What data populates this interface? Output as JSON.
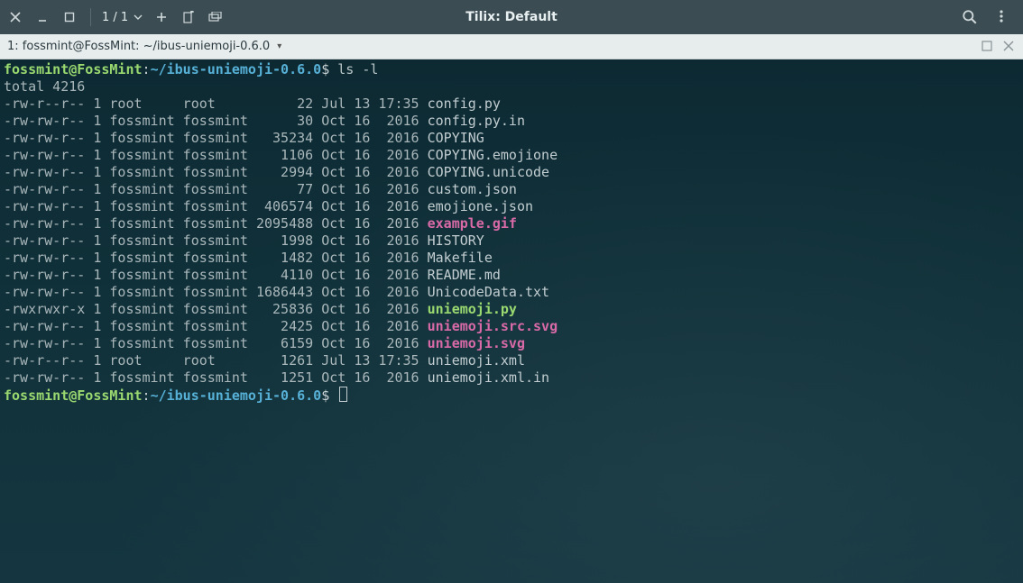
{
  "titlebar": {
    "pager": "1 / 1",
    "title": "Tilix: Default"
  },
  "tab": {
    "label": "1: fossmint@FossMint: ~/ibus-uniemoji-0.6.0"
  },
  "prompt": {
    "user_host": "fossmint@FossMint",
    "sep": ":",
    "path": "~/ibus-uniemoji-0.6.0",
    "dollar": "$",
    "cmd": "ls -l"
  },
  "total_line": "total 4216",
  "files": [
    {
      "perm": "-rw-r--r--",
      "links": "1",
      "owner": "root    ",
      "group": "root    ",
      "size": "     22",
      "date": "Jul 13 17:35",
      "name": "config.py",
      "cls": "c-file"
    },
    {
      "perm": "-rw-rw-r--",
      "links": "1",
      "owner": "fossmint",
      "group": "fossmint",
      "size": "     30",
      "date": "Oct 16  2016",
      "name": "config.py.in",
      "cls": "c-file"
    },
    {
      "perm": "-rw-rw-r--",
      "links": "1",
      "owner": "fossmint",
      "group": "fossmint",
      "size": "  35234",
      "date": "Oct 16  2016",
      "name": "COPYING",
      "cls": "c-file"
    },
    {
      "perm": "-rw-rw-r--",
      "links": "1",
      "owner": "fossmint",
      "group": "fossmint",
      "size": "   1106",
      "date": "Oct 16  2016",
      "name": "COPYING.emojione",
      "cls": "c-file"
    },
    {
      "perm": "-rw-rw-r--",
      "links": "1",
      "owner": "fossmint",
      "group": "fossmint",
      "size": "   2994",
      "date": "Oct 16  2016",
      "name": "COPYING.unicode",
      "cls": "c-file"
    },
    {
      "perm": "-rw-rw-r--",
      "links": "1",
      "owner": "fossmint",
      "group": "fossmint",
      "size": "     77",
      "date": "Oct 16  2016",
      "name": "custom.json",
      "cls": "c-file"
    },
    {
      "perm": "-rw-rw-r--",
      "links": "1",
      "owner": "fossmint",
      "group": "fossmint",
      "size": " 406574",
      "date": "Oct 16  2016",
      "name": "emojione.json",
      "cls": "c-file"
    },
    {
      "perm": "-rw-rw-r--",
      "links": "1",
      "owner": "fossmint",
      "group": "fossmint",
      "size": "2095488",
      "date": "Oct 16  2016",
      "name": "example.gif",
      "cls": "c-img"
    },
    {
      "perm": "-rw-rw-r--",
      "links": "1",
      "owner": "fossmint",
      "group": "fossmint",
      "size": "   1998",
      "date": "Oct 16  2016",
      "name": "HISTORY",
      "cls": "c-file"
    },
    {
      "perm": "-rw-rw-r--",
      "links": "1",
      "owner": "fossmint",
      "group": "fossmint",
      "size": "   1482",
      "date": "Oct 16  2016",
      "name": "Makefile",
      "cls": "c-file"
    },
    {
      "perm": "-rw-rw-r--",
      "links": "1",
      "owner": "fossmint",
      "group": "fossmint",
      "size": "   4110",
      "date": "Oct 16  2016",
      "name": "README.md",
      "cls": "c-file"
    },
    {
      "perm": "-rw-rw-r--",
      "links": "1",
      "owner": "fossmint",
      "group": "fossmint",
      "size": "1686443",
      "date": "Oct 16  2016",
      "name": "UnicodeData.txt",
      "cls": "c-file"
    },
    {
      "perm": "-rwxrwxr-x",
      "links": "1",
      "owner": "fossmint",
      "group": "fossmint",
      "size": "  25836",
      "date": "Oct 16  2016",
      "name": "uniemoji.py",
      "cls": "c-exec"
    },
    {
      "perm": "-rw-rw-r--",
      "links": "1",
      "owner": "fossmint",
      "group": "fossmint",
      "size": "   2425",
      "date": "Oct 16  2016",
      "name": "uniemoji.src.svg",
      "cls": "c-img"
    },
    {
      "perm": "-rw-rw-r--",
      "links": "1",
      "owner": "fossmint",
      "group": "fossmint",
      "size": "   6159",
      "date": "Oct 16  2016",
      "name": "uniemoji.svg",
      "cls": "c-img"
    },
    {
      "perm": "-rw-r--r--",
      "links": "1",
      "owner": "root    ",
      "group": "root    ",
      "size": "   1261",
      "date": "Jul 13 17:35",
      "name": "uniemoji.xml",
      "cls": "c-file"
    },
    {
      "perm": "-rw-rw-r--",
      "links": "1",
      "owner": "fossmint",
      "group": "fossmint",
      "size": "   1251",
      "date": "Oct 16  2016",
      "name": "uniemoji.xml.in",
      "cls": "c-file"
    }
  ]
}
